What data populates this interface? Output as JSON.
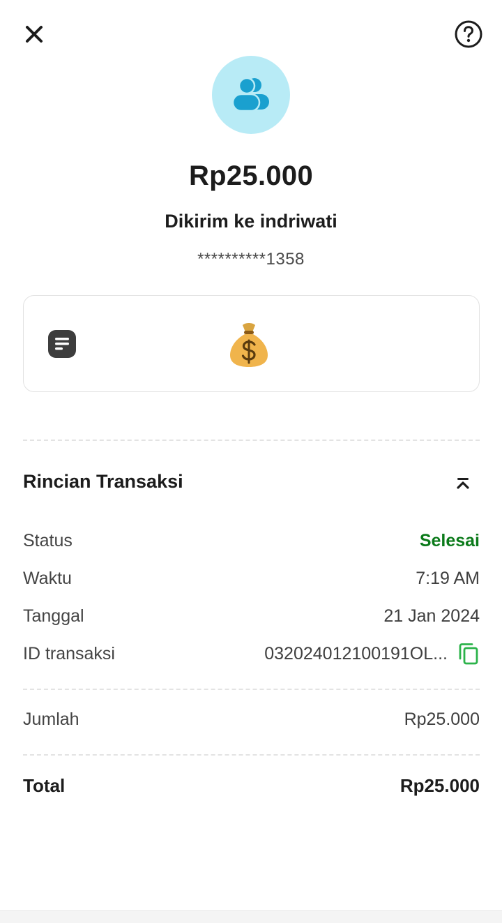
{
  "header": {
    "close_icon": "close-icon",
    "help_icon": "help-icon"
  },
  "recipient": {
    "avatar_icon": "users-icon",
    "amount": "Rp25.000",
    "sent_to": "Dikirim ke indriwati",
    "account_number": "**********1358"
  },
  "note": {
    "icon": "note-icon",
    "emoji": "money-bag"
  },
  "details": {
    "title": "Rincian Transaksi",
    "collapse_icon": "chevron-up-icon",
    "rows": [
      {
        "label": "Status",
        "value": "Selesai"
      },
      {
        "label": "Waktu",
        "value": "7:19 AM"
      },
      {
        "label": "Tanggal",
        "value": "21 Jan 2024"
      },
      {
        "label": "ID transaksi",
        "value": "032024012100191OL..."
      }
    ],
    "amount_row": {
      "label": "Jumlah",
      "value": "Rp25.000"
    },
    "total_row": {
      "label": "Total",
      "value": "Rp25.000"
    }
  },
  "colors": {
    "status_green": "#0b7a1a",
    "copy_green": "#2bb34a",
    "avatar_bg": "#b8ebf6",
    "avatar_icon": "#1aa0cf"
  }
}
